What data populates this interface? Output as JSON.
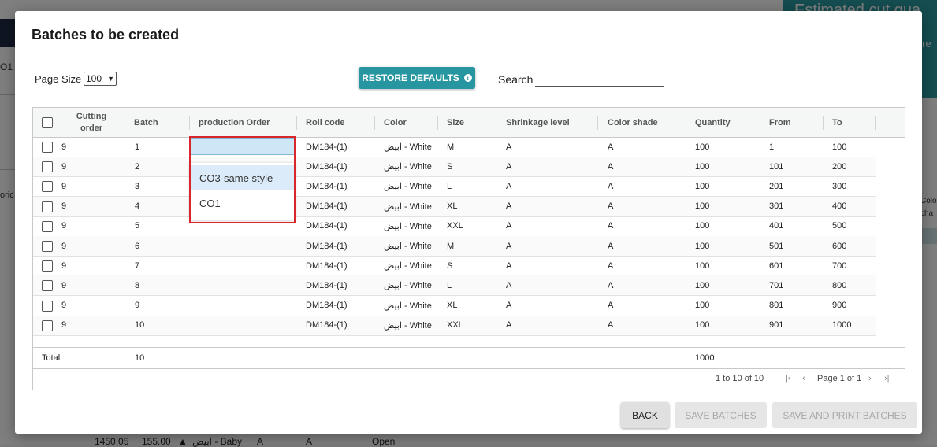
{
  "background": {
    "teal_title": "Estimated cut qua",
    "teal_sub": "uire",
    "left_label_1": "O1",
    "left_label_2": "oric",
    "right_label": "Colo\ncha",
    "bottom_row": [
      "1450.05",
      "155.00",
      "▲",
      "ابيض - Baby",
      "A",
      "A",
      "Open"
    ]
  },
  "modal": {
    "title": "Batches to be created",
    "page_size_label": "Page Size",
    "page_size_value": "100",
    "restore_label": "RESTORE DEFAULTS",
    "search_label": "Search",
    "search_value": ""
  },
  "grid": {
    "columns": [
      "Cutting order",
      "Batch",
      "production Order",
      "Roll code",
      "Color",
      "Size",
      "Shrinkage level",
      "Color shade",
      "Quantity",
      "From",
      "To"
    ],
    "rows": [
      {
        "cutting": "9",
        "batch": "1",
        "po": "",
        "roll": "DM184-(1)",
        "color": "ابيض - White",
        "size": "M",
        "shrink": "A",
        "shade": "A",
        "qty": "100",
        "from": "1",
        "to": "100"
      },
      {
        "cutting": "9",
        "batch": "2",
        "po": "",
        "roll": "DM184-(1)",
        "color": "ابيض - White",
        "size": "S",
        "shrink": "A",
        "shade": "A",
        "qty": "100",
        "from": "101",
        "to": "200"
      },
      {
        "cutting": "9",
        "batch": "3",
        "po": "",
        "roll": "DM184-(1)",
        "color": "ابيض - White",
        "size": "L",
        "shrink": "A",
        "shade": "A",
        "qty": "100",
        "from": "201",
        "to": "300"
      },
      {
        "cutting": "9",
        "batch": "4",
        "po": "",
        "roll": "DM184-(1)",
        "color": "ابيض - White",
        "size": "XL",
        "shrink": "A",
        "shade": "A",
        "qty": "100",
        "from": "301",
        "to": "400"
      },
      {
        "cutting": "9",
        "batch": "5",
        "po": "",
        "roll": "DM184-(1)",
        "color": "ابيض - White",
        "size": "XXL",
        "shrink": "A",
        "shade": "A",
        "qty": "100",
        "from": "401",
        "to": "500"
      },
      {
        "cutting": "9",
        "batch": "6",
        "po": "",
        "roll": "DM184-(1)",
        "color": "ابيض - White",
        "size": "M",
        "shrink": "A",
        "shade": "A",
        "qty": "100",
        "from": "501",
        "to": "600"
      },
      {
        "cutting": "9",
        "batch": "7",
        "po": "",
        "roll": "DM184-(1)",
        "color": "ابيض - White",
        "size": "S",
        "shrink": "A",
        "shade": "A",
        "qty": "100",
        "from": "601",
        "to": "700"
      },
      {
        "cutting": "9",
        "batch": "8",
        "po": "",
        "roll": "DM184-(1)",
        "color": "ابيض - White",
        "size": "L",
        "shrink": "A",
        "shade": "A",
        "qty": "100",
        "from": "701",
        "to": "800"
      },
      {
        "cutting": "9",
        "batch": "9",
        "po": "",
        "roll": "DM184-(1)",
        "color": "ابيض - White",
        "size": "XL",
        "shrink": "A",
        "shade": "A",
        "qty": "100",
        "from": "801",
        "to": "900"
      },
      {
        "cutting": "9",
        "batch": "10",
        "po": "",
        "roll": "DM184-(1)",
        "color": "ابيض - White",
        "size": "XXL",
        "shrink": "A",
        "shade": "A",
        "qty": "100",
        "from": "901",
        "to": "1000"
      }
    ],
    "total": {
      "label": "Total",
      "batch": "10",
      "qty": "1000"
    },
    "pager": {
      "range": "1 to 10 of 10",
      "page": "Page 1 of 1"
    }
  },
  "dropdown": {
    "current_value": "",
    "options": [
      "CO3-same style",
      "CO1"
    ],
    "selected_index": 0
  },
  "footer": {
    "back": "BACK",
    "save": "SAVE BATCHES",
    "save_print": "SAVE AND PRINT BATCHES"
  },
  "colors": {
    "accent": "#2796a0",
    "highlight_border": "#d8262c",
    "editor_bg": "#cde7f7",
    "selected_option_bg": "#dcebfa"
  }
}
